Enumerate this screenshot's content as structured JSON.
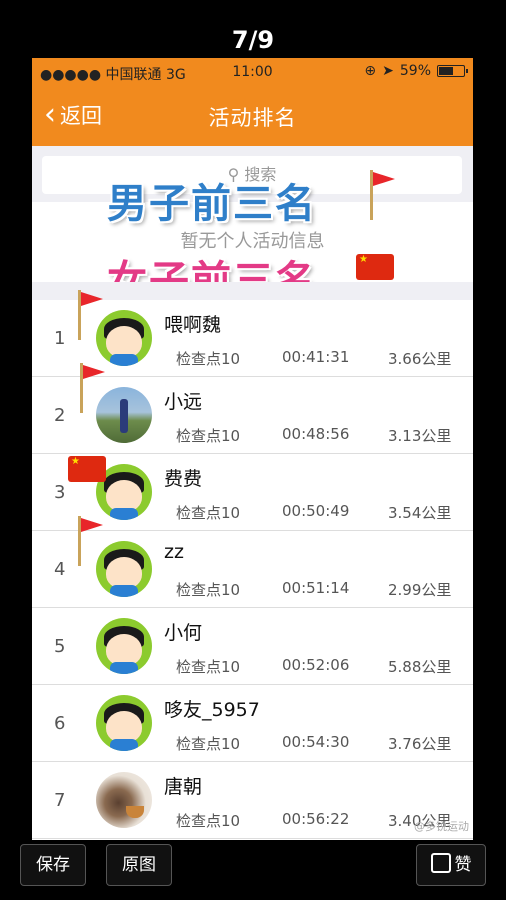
{
  "viewer": {
    "counter": "7/9",
    "save_label": "保存",
    "original_label": "原图",
    "like_label": "赞"
  },
  "statusbar": {
    "carrier": "●●●●● 中国联通 3G",
    "time": "11:00",
    "battery": "59%",
    "battery_level": 0.59
  },
  "navbar": {
    "back_label": "返回",
    "title": "活动排名"
  },
  "search": {
    "placeholder": "搜索"
  },
  "empty_message": "暂无个人活动信息",
  "overlays": {
    "male": "男子前三名",
    "female": "女子前三名"
  },
  "rankings": [
    {
      "rank": "1",
      "name": "喂啊魏",
      "checkpoint": "检查点10",
      "time": "00:41:31",
      "distance": "3.66公里",
      "avatar": "cartoon-boy",
      "flag": "red-flag"
    },
    {
      "rank": "2",
      "name": "小远",
      "checkpoint": "检查点10",
      "time": "00:48:56",
      "distance": "3.13公里",
      "avatar": "photo-field",
      "flag": "red-flag"
    },
    {
      "rank": "3",
      "name": "费费",
      "checkpoint": "检查点10",
      "time": "00:50:49",
      "distance": "3.54公里",
      "avatar": "cartoon-boy",
      "flag": "china-flag"
    },
    {
      "rank": "4",
      "name": "zz",
      "checkpoint": "检查点10",
      "time": "00:51:14",
      "distance": "2.99公里",
      "avatar": "cartoon-boy",
      "flag": "red-flag"
    },
    {
      "rank": "5",
      "name": "小何",
      "checkpoint": "检查点10",
      "time": "00:52:06",
      "distance": "5.88公里",
      "avatar": "cartoon-boy",
      "flag": ""
    },
    {
      "rank": "6",
      "name": "哆友_5957",
      "checkpoint": "检查点10",
      "time": "00:54:30",
      "distance": "3.76公里",
      "avatar": "cartoon-boy",
      "flag": ""
    },
    {
      "rank": "7",
      "name": "唐朝",
      "checkpoint": "检查点10",
      "time": "00:56:22",
      "distance": "3.40公里",
      "avatar": "photo-tea",
      "flag": ""
    }
  ],
  "watermark": "@多锐运动",
  "colors": {
    "accent": "#f18a1e",
    "male_text": "#2f7fc9",
    "female_text": "#e33a86"
  }
}
